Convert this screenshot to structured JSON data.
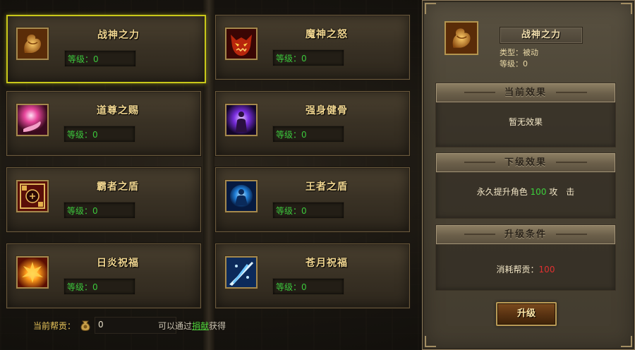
{
  "skills": [
    {
      "name": "战神之力",
      "level": "等级：0",
      "icon": "flexed-arm-icon",
      "selected": true
    },
    {
      "name": "魔神之怒",
      "level": "等级：0",
      "icon": "demon-face-icon",
      "selected": false
    },
    {
      "name": "道尊之赐",
      "level": "等级：0",
      "icon": "energy-hand-icon",
      "selected": false
    },
    {
      "name": "强身健骨",
      "level": "等级：0",
      "icon": "purple-aura-body-icon",
      "selected": false
    },
    {
      "name": "霸者之盾",
      "level": "等级：0",
      "icon": "rune-shield-icon",
      "selected": false
    },
    {
      "name": "王者之盾",
      "level": "等级：0",
      "icon": "blue-globe-warrior-icon",
      "selected": false
    },
    {
      "name": "日炎祝福",
      "level": "等级：0",
      "icon": "fire-burst-icon",
      "selected": false
    },
    {
      "name": "苍月祝福",
      "level": "等级：0",
      "icon": "ice-slash-icon",
      "selected": false
    }
  ],
  "detail": {
    "icon": "flexed-arm-icon",
    "title": "战神之力",
    "type_label": "类型：",
    "type_value": "被动",
    "level_label": "等级：",
    "level_value": "0",
    "current_effect_title": "当前效果",
    "current_effect_text": "暂无效果",
    "next_effect_title": "下级效果",
    "next_effect_prefix": "永久提升角色",
    "next_effect_value": "100",
    "next_effect_suffix": "攻　击",
    "upgrade_cond_title": "升级条件",
    "upgrade_cond_label": "消耗帮贡：",
    "upgrade_cond_value": "100",
    "upgrade_button": "升级"
  },
  "footer": {
    "contrib_label": "当前帮贡：",
    "contrib_icon": "coin-bag-icon",
    "contrib_value": "0",
    "hint_prefix": "可以通过",
    "hint_link": "捐献",
    "hint_suffix": "获得"
  },
  "colors": {
    "level_green": "#3cc73c",
    "selected_border": "#c9c81a",
    "name_gold": "#f1d690",
    "red_value": "#e03030"
  }
}
